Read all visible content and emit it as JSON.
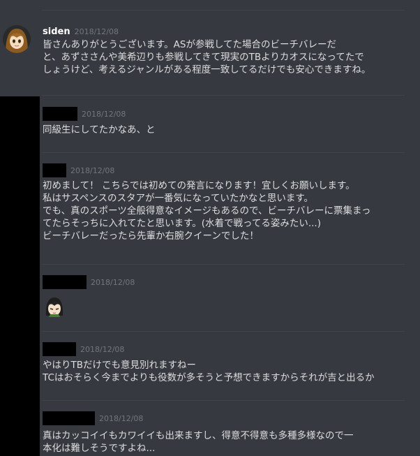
{
  "colors": {
    "background": "#36393f",
    "username": "#ffffff",
    "text": "#dcddde",
    "timestamp": "#72767d",
    "redaction": "#000000"
  },
  "messages": [
    {
      "username": "siden",
      "timestamp": "2018/12/08",
      "avatar": "anime-girl-avatar",
      "lines": [
        "皆さんありがとうございます。ASが参戦してた場合のビーチバレーだ",
        "と、あずささんや美希辺りも参戦してきて現実のTBよりカオスになってたで",
        "しょうけど、考えるジャンルがある程度一致してるだけでも安心できますね。"
      ]
    },
    {
      "username": "",
      "timestamp": "2018/12/08",
      "lines": [
        "同級生にしてたかなあ、と"
      ]
    },
    {
      "username": "",
      "timestamp": "2018/12/08",
      "lines": [
        "初めまして！ こちらでは初めての発言になります！宜しくお願いします。",
        "私はサスペンスのスタアが一番気になっていたかなと思います。",
        "でも、真のスポーツ全般得意なイメージもあるので、ビーチバレーに票集まっ",
        "てたらそっちに入れてたと思います。(水着で戦ってる姿みたい...)",
        "ビーチバレーだったら先輩か右腕クイーンでした！"
      ]
    },
    {
      "username": "",
      "timestamp": "2018/12/08",
      "emoji": "anime-character-emoji",
      "lines": []
    },
    {
      "username": "",
      "timestamp": "2018/12/08",
      "lines": [
        "やはりTBだけでも意見別れますねー",
        "TCはおそらく今までよりも役数が多そうと予想できますからそれが吉と出るか"
      ]
    },
    {
      "username": "",
      "timestamp": "2018/12/08",
      "lines": [
        "真はカッコイイもカワイイも出来ますし、得意不得意も多種多様なので一",
        "本化は難しそうですよね..."
      ]
    }
  ]
}
